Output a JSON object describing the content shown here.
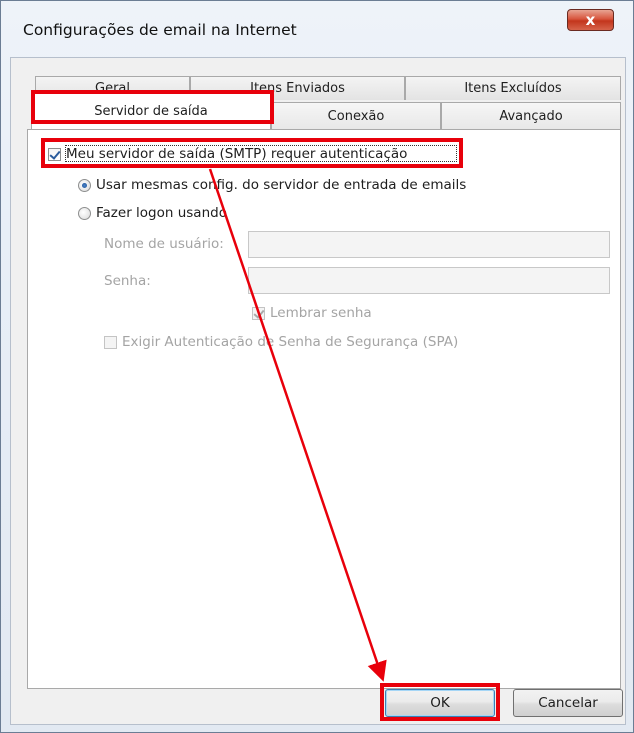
{
  "window": {
    "title": "Configurações de email na Internet",
    "close_symbol": "x"
  },
  "tabs": {
    "back_row": [
      "Geral",
      "Itens Enviados",
      "Itens Excluídos"
    ],
    "front_row": [
      "Servidor de saída",
      "Conexão",
      "Avançado"
    ],
    "active": "Servidor de saída"
  },
  "form": {
    "smtp_auth_label": "Meu servidor de saída (SMTP) requer autenticação",
    "smtp_auth_checked": true,
    "radio_same_label": "Usar mesmas config. do servidor de entrada de emails",
    "radio_same_selected": true,
    "radio_logon_label": "Fazer logon usando",
    "username_label": "Nome de usuário:",
    "username_value": "",
    "password_label": "Senha:",
    "password_value": "",
    "remember_label": "Lembrar senha",
    "remember_checked": true,
    "spa_label": "Exigir Autenticação de Senha de Segurança (SPA)",
    "spa_checked": false
  },
  "buttons": {
    "ok": "OK",
    "cancel": "Cancelar"
  },
  "colors": {
    "annotation_red": "#e8000b",
    "close_red": "#c3351c"
  }
}
